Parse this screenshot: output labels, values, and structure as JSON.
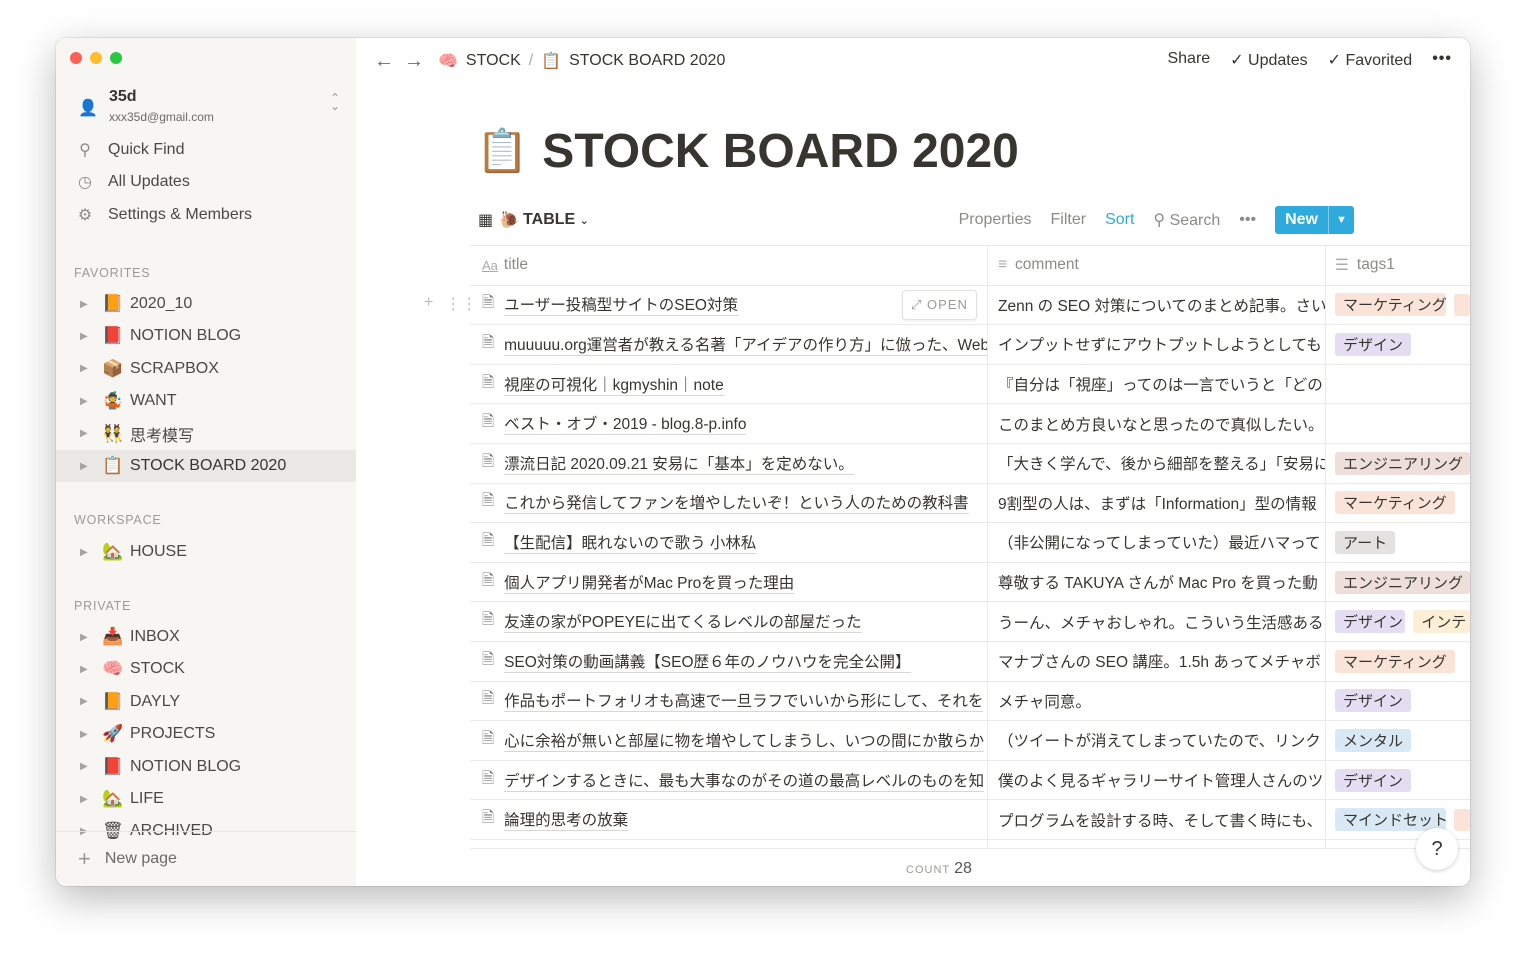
{
  "workspace": {
    "name": "35d",
    "email": "xxx35d@gmail.com"
  },
  "nav": [
    {
      "icon": "search-icon",
      "label": "Quick Find"
    },
    {
      "icon": "clock-icon",
      "label": "All Updates"
    },
    {
      "icon": "gear-icon",
      "label": "Settings & Members"
    }
  ],
  "sections": {
    "favorites": "FAVORITES",
    "workspace": "WORKSPACE",
    "private": "PRIVATE"
  },
  "favorites": [
    {
      "emoji": "📙",
      "label": "2020_10"
    },
    {
      "emoji": "📕",
      "label": "NOTION BLOG"
    },
    {
      "emoji": "📦",
      "label": "SCRAPBOX"
    },
    {
      "emoji": "🤹",
      "label": "WANT"
    },
    {
      "emoji": "👯",
      "label": "思考模写"
    },
    {
      "emoji": "📋",
      "label": "STOCK BOARD 2020",
      "active": true
    }
  ],
  "workspace_pages": [
    {
      "emoji": "🏡",
      "label": "HOUSE"
    }
  ],
  "private": [
    {
      "emoji": "📥",
      "label": "INBOX"
    },
    {
      "emoji": "🧠",
      "label": "STOCK"
    },
    {
      "emoji": "📙",
      "label": "DAYLY"
    },
    {
      "emoji": "🚀",
      "label": "PROJECTS"
    },
    {
      "emoji": "📕",
      "label": "NOTION BLOG"
    },
    {
      "emoji": "🏡",
      "label": "LIFE"
    },
    {
      "emoji": "🗑",
      "label": "ARCHIVED"
    }
  ],
  "new_page": "New page",
  "breadcrumb": [
    {
      "emoji": "🧠",
      "label": "STOCK"
    },
    {
      "emoji": "📋",
      "label": "STOCK BOARD 2020"
    }
  ],
  "topbar": {
    "share": "Share",
    "updates": "Updates",
    "favorited": "Favorited"
  },
  "page": {
    "emoji": "📋",
    "title": "STOCK BOARD 2020"
  },
  "view": {
    "emoji": "🐌",
    "name": "TABLE",
    "properties": "Properties",
    "filter": "Filter",
    "sort": "Sort",
    "search": "Search",
    "new": "New"
  },
  "columns": {
    "title": "title",
    "comment": "comment",
    "tags": "tags1"
  },
  "open_label": "OPEN",
  "tag_colors": {
    "マーケティング": "#fae3d8",
    "デザイン": "#e4def2",
    "エンジニアリング": "#eedfda",
    "アート": "#e3e2e0",
    "メンタル": "#d8e8f4",
    "マインドセット": "#d8e8f4",
    "インテ": "#fbf0d5"
  },
  "rows": [
    {
      "title": "ユーザー投稿型サイトのSEO対策",
      "comment": "Zenn の SEO 対策についてのまとめ記事。さい",
      "tags": [
        "マーケティング",
        ""
      ]
    },
    {
      "title": "muuuuu.org運営者が教える名著「アイデアの作り方」に倣った、Web",
      "comment": "インプットせずにアウトプットしようとしても",
      "tags": [
        "デザイン"
      ]
    },
    {
      "title": "視座の可視化｜kgmyshin｜note",
      "comment": "『自分は「視座」ってのは一言でいうと「どの",
      "tags": []
    },
    {
      "title": "ベスト・オブ・2019 - blog.8-p.info",
      "comment": "このまとめ方良いなと思ったので真似したい。",
      "tags": []
    },
    {
      "title": "漂流日記 2020.09.21 安易に「基本」を定めない。",
      "comment": "「大きく学んで、後から細部を整える」「安易に",
      "tags": [
        "エンジニアリング"
      ]
    },
    {
      "title": "これから発信してファンを増やしたいぞ！という人のための教科書",
      "comment": "9割型の人は、まずは「Information」型の情報",
      "tags": [
        "マーケティング"
      ]
    },
    {
      "title": "【生配信】眠れないので歌う 小林私",
      "comment": "（非公開になってしまっていた）最近ハマって",
      "tags": [
        "アート"
      ]
    },
    {
      "title": "個人アプリ開発者がMac Proを買った理由",
      "comment": "尊敬する TAKUYA さんが Mac Pro を買った動",
      "tags": [
        "エンジニアリング"
      ]
    },
    {
      "title": "友達の家がPOPEYEに出てくるレベルの部屋だった",
      "comment": "うーん、メチャおしゃれ。こういう生活感ある",
      "tags": [
        "デザイン",
        "インテ"
      ]
    },
    {
      "title": "SEO対策の動画講義【SEO歴６年のノウハウを完全公開】",
      "comment": "マナブさんの SEO 講座。1.5h あってメチャボ",
      "tags": [
        "マーケティング"
      ]
    },
    {
      "title": "作品もポートフォリオも高速で一旦ラフでいいから形にして、それを",
      "comment": "メチャ同意。",
      "tags": [
        "デザイン"
      ]
    },
    {
      "title": "心に余裕が無いと部屋に物を増やしてしまうし、いつの間にか散らか",
      "comment": "（ツイートが消えてしまっていたので、リンク",
      "tags": [
        "メンタル"
      ]
    },
    {
      "title": "デザインするときに、最も大事なのがその道の最高レベルのものを知",
      "comment": "僕のよく見るギャラリーサイト管理人さんのツ",
      "tags": [
        "デザイン"
      ]
    },
    {
      "title": "論理的思考の放棄",
      "comment": "プログラムを設計する時、そして書く時にも、",
      "tags": [
        "マインドセット",
        ""
      ]
    }
  ],
  "footer": {
    "count_label": "COUNT",
    "count": "28"
  },
  "help": "?"
}
